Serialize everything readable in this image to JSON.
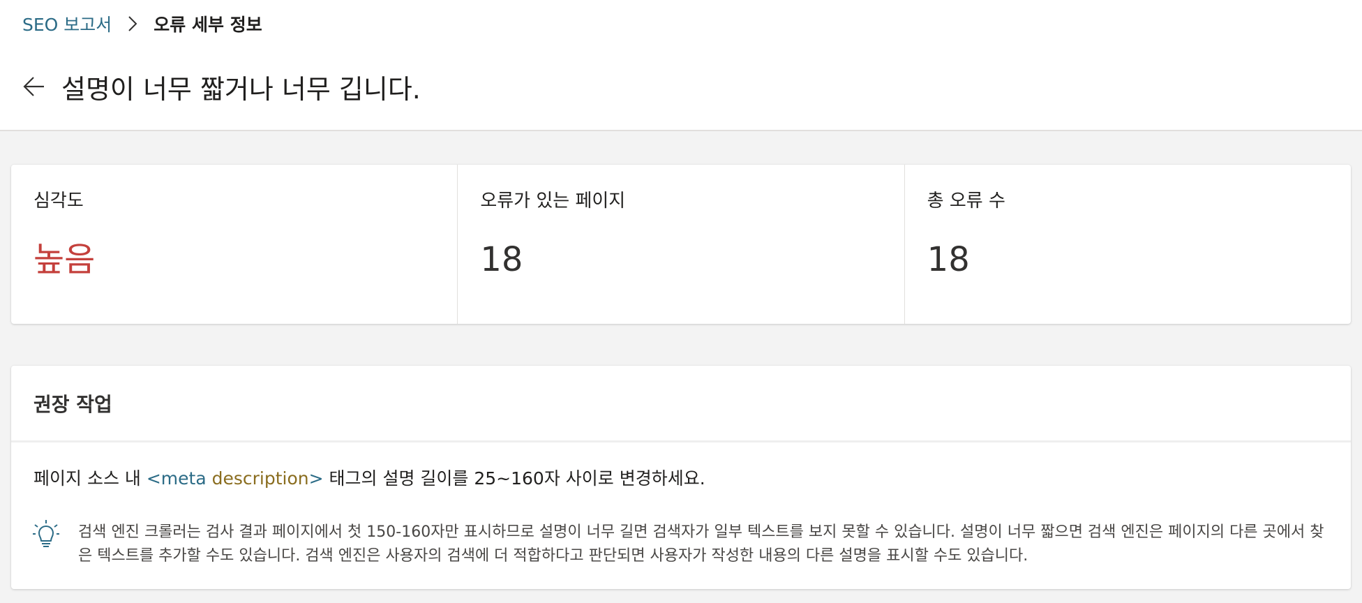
{
  "breadcrumb": {
    "parent": "SEO 보고서",
    "current": "오류 세부 정보"
  },
  "page": {
    "title": "설명이 너무 짧거나 너무 깁니다."
  },
  "metrics": {
    "severity": {
      "label": "심각도",
      "value": "높음"
    },
    "pages_with_errors": {
      "label": "오류가 있는 페이지",
      "value": "18"
    },
    "total_errors": {
      "label": "총 오류 수",
      "value": "18"
    }
  },
  "recommended_actions": {
    "title": "권장 작업",
    "instruction_prefix": "페이지 소스 내 ",
    "code_tag_open": "<meta ",
    "code_attr": "description",
    "code_tag_close": ">",
    "instruction_suffix": " 태그의 설명 길이를 25~160자 사이로 변경하세요.",
    "tip": "검색 엔진 크롤러는 검사 결과 페이지에서 첫 150-160자만 표시하므로 설명이 너무 길면 검색자가 일부 텍스트를 보지 못할 수 있습니다. 설명이 너무 짧으면 검색 엔진은 페이지의 다른 곳에서 찾은 텍스트를 추가할 수도 있습니다. 검색 엔진은 사용자의 검색에 더 적합하다고 판단되면 사용자가 작성한 내용의 다른 설명을 표시할 수도 있습니다."
  },
  "icons": {
    "back": "arrow-left-icon",
    "separator": "chevron-right-icon",
    "tip": "lightbulb-icon"
  },
  "colors": {
    "link": "#2b6b86",
    "severity_high": "#c4403c",
    "code_attr": "#8a6d1f"
  }
}
